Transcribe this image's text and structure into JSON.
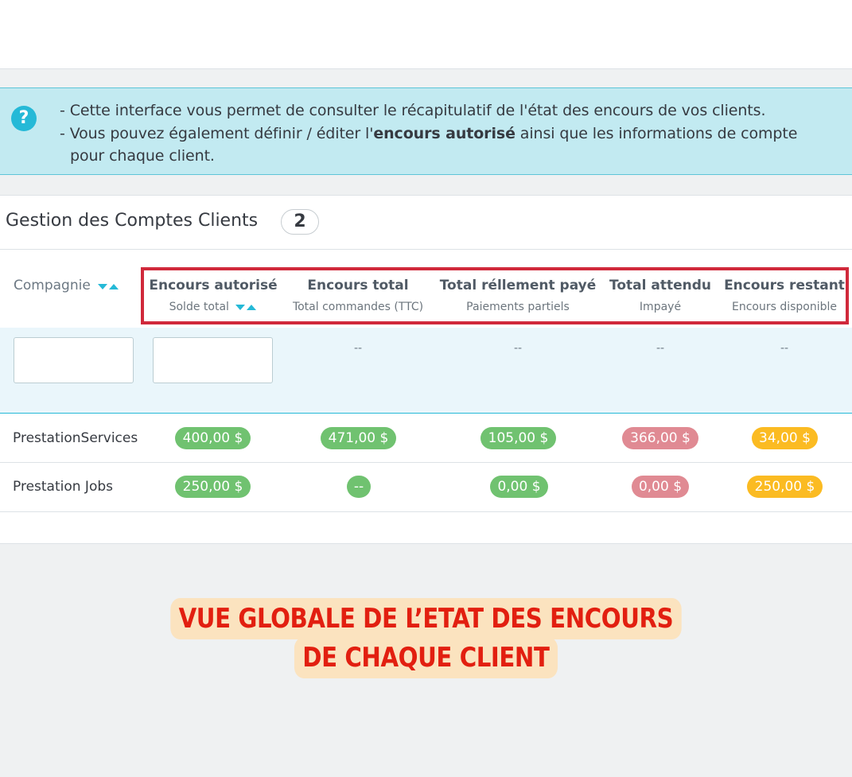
{
  "info": {
    "line1": "- Cette interface vous permet de consulter le récapitulatif de l'état des encours de vos clients.",
    "line2_pre": "- Vous pouvez également définir / éditer l'",
    "line2_bold": "encours autorisé",
    "line2_post": " ainsi que les informations de compte",
    "line3": "pour chaque client.",
    "icon_glyph": "?"
  },
  "panel": {
    "title": "Gestion des Comptes Clients",
    "count": "2"
  },
  "columns": [
    {
      "title": "Compagnie",
      "subtitle": "",
      "sortable": true
    },
    {
      "title": "Encours autorisé",
      "subtitle": "Solde total",
      "sortable": true
    },
    {
      "title": "Encours total",
      "subtitle": "Total commandes (TTC)",
      "sortable": false
    },
    {
      "title": "Total réllement payé",
      "subtitle": "Paiements partiels",
      "sortable": false
    },
    {
      "title": "Total attendu",
      "subtitle": "Impayé",
      "sortable": false
    },
    {
      "title": "Encours restant",
      "subtitle": "Encours disponible",
      "sortable": false
    }
  ],
  "filters": {
    "compagnie_value": "",
    "encours_value": "",
    "empty": "--"
  },
  "rows": [
    {
      "company": "PrestationServices",
      "encours_autorise": "400,00 $",
      "encours_total": "471,00 $",
      "paye": "105,00 $",
      "attendu": "366,00 $",
      "restant": "34,00 $"
    },
    {
      "company": "Prestation Jobs",
      "encours_autorise": "250,00 $",
      "encours_total": "--",
      "paye": "0,00 $",
      "attendu": "0,00 $",
      "restant": "250,00 $"
    }
  ],
  "colors": {
    "green": "#70c270",
    "red": "#e08a93",
    "yellow": "#fbbb22",
    "highlight": "#d0293b",
    "accent": "#25b9d7"
  },
  "banner": {
    "line1": "VUE GLOBALE DE L’ETAT DES ENCOURS",
    "line2": "DE CHAQUE CLIENT"
  }
}
